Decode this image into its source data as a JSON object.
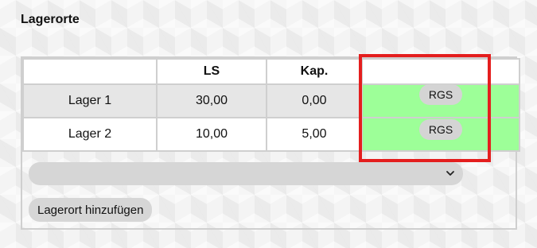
{
  "section": {
    "title": "Lagerorte"
  },
  "table": {
    "headers": [
      "",
      "LS",
      "Kap.",
      ""
    ],
    "rows": [
      {
        "name": "Lager 1",
        "ls": "30,00",
        "kap": "0,00",
        "action": "RGS"
      },
      {
        "name": "Lager 2",
        "ls": "10,00",
        "kap": "5,00",
        "action": "RGS"
      }
    ]
  },
  "select": {
    "value": ""
  },
  "buttons": {
    "add_location": "Lagerort hinzufügen"
  },
  "colors": {
    "highlight_frame": "#e41e1e",
    "action_cell": "#9dff98",
    "button_bg": "#d6d6d6"
  },
  "icons": {
    "select_arrow": "chevron-down-icon"
  }
}
